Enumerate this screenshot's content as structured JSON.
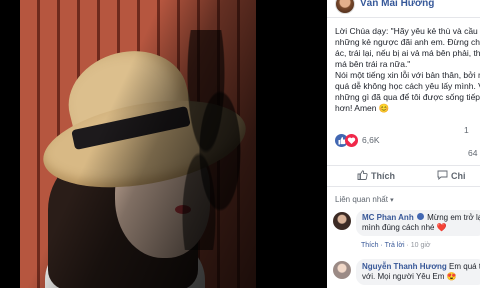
{
  "post": {
    "author": "Văn Mai Hương",
    "lines": [
      "Lời Chúa dạy: \"Hãy yêu kẻ thù và cầu ng",
      "những kẻ ngược đãi anh em. Đừng chống",
      "ác, trái lại, nếu bị ai vả má bên phải, thì",
      "má bên trái ra nữa.\"",
      "Nói một tiếng xin lỗi với bản thân, bởi mình",
      "quá dễ không học cách yêu lấy mình. Và",
      "những gì đã qua để tôi được sống tiếp,",
      "hơn! Amen 😊"
    ]
  },
  "stats": {
    "reaction_count": "6,6K",
    "comment_count": "1",
    "share_count": "64"
  },
  "actions": {
    "like_label": "Thích",
    "comment_label": "Chi"
  },
  "filter": {
    "label": "Liên quan nhất"
  },
  "comments": [
    {
      "name": "MC Phan Anh",
      "text_1": "Mừng em trở lại y",
      "text_2": "mình đúng cách nhé ❤️",
      "meta_like": "Thích",
      "meta_reply": "· Trả lời",
      "meta_time": "· 10 giờ"
    },
    {
      "name": "Nguyễn Thanh Hương",
      "text_1": "Em quá t",
      "text_2": "với. Mọi người Yêu Em 😍"
    }
  ],
  "icons": {
    "like_reaction": "thumbs-up-icon",
    "love_reaction": "heart-icon",
    "like_action": "thumbs-up-outline-icon",
    "comment_action": "comment-bubble-icon",
    "filter_chevron": "chevron-down-icon",
    "verified": "verified-badge-icon"
  },
  "colors": {
    "link": "#385898",
    "like_blue": "#4267b2",
    "love_red": "#f0284a",
    "meta_gray": "#90949c"
  }
}
